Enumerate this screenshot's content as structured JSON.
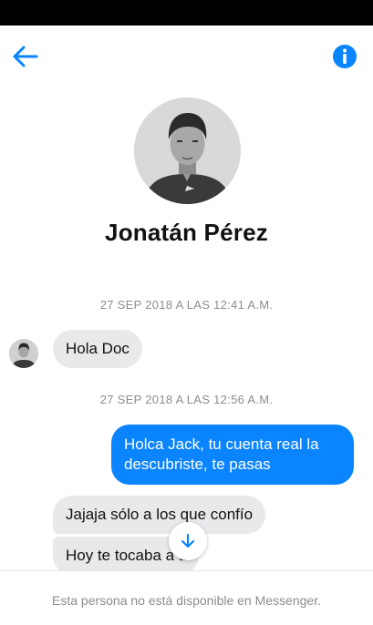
{
  "header": {
    "back_icon": "back-arrow-icon",
    "info_icon": "info-icon",
    "accent_color": "#0a84ff"
  },
  "profile": {
    "name": "Jonatán Pérez",
    "photo": "profile-photo"
  },
  "messages": [
    {
      "timestamp": "27 SEP 2018 A LAS 12:41 A.M."
    },
    {
      "sender": "them",
      "text": "Hola Doc"
    },
    {
      "timestamp": "27 SEP 2018 A LAS 12:56 A.M."
    },
    {
      "sender": "me",
      "text": "Holca Jack, tu cuenta real la descubriste, te pasas"
    },
    {
      "sender": "them",
      "text": "Jajaja sólo a los que confío"
    },
    {
      "sender": "them",
      "text": "Hoy te tocaba a ti"
    }
  ],
  "scroll_button_icon": "arrow-down-icon",
  "footer": {
    "notice": "Esta persona no está disponible en Messenger."
  }
}
